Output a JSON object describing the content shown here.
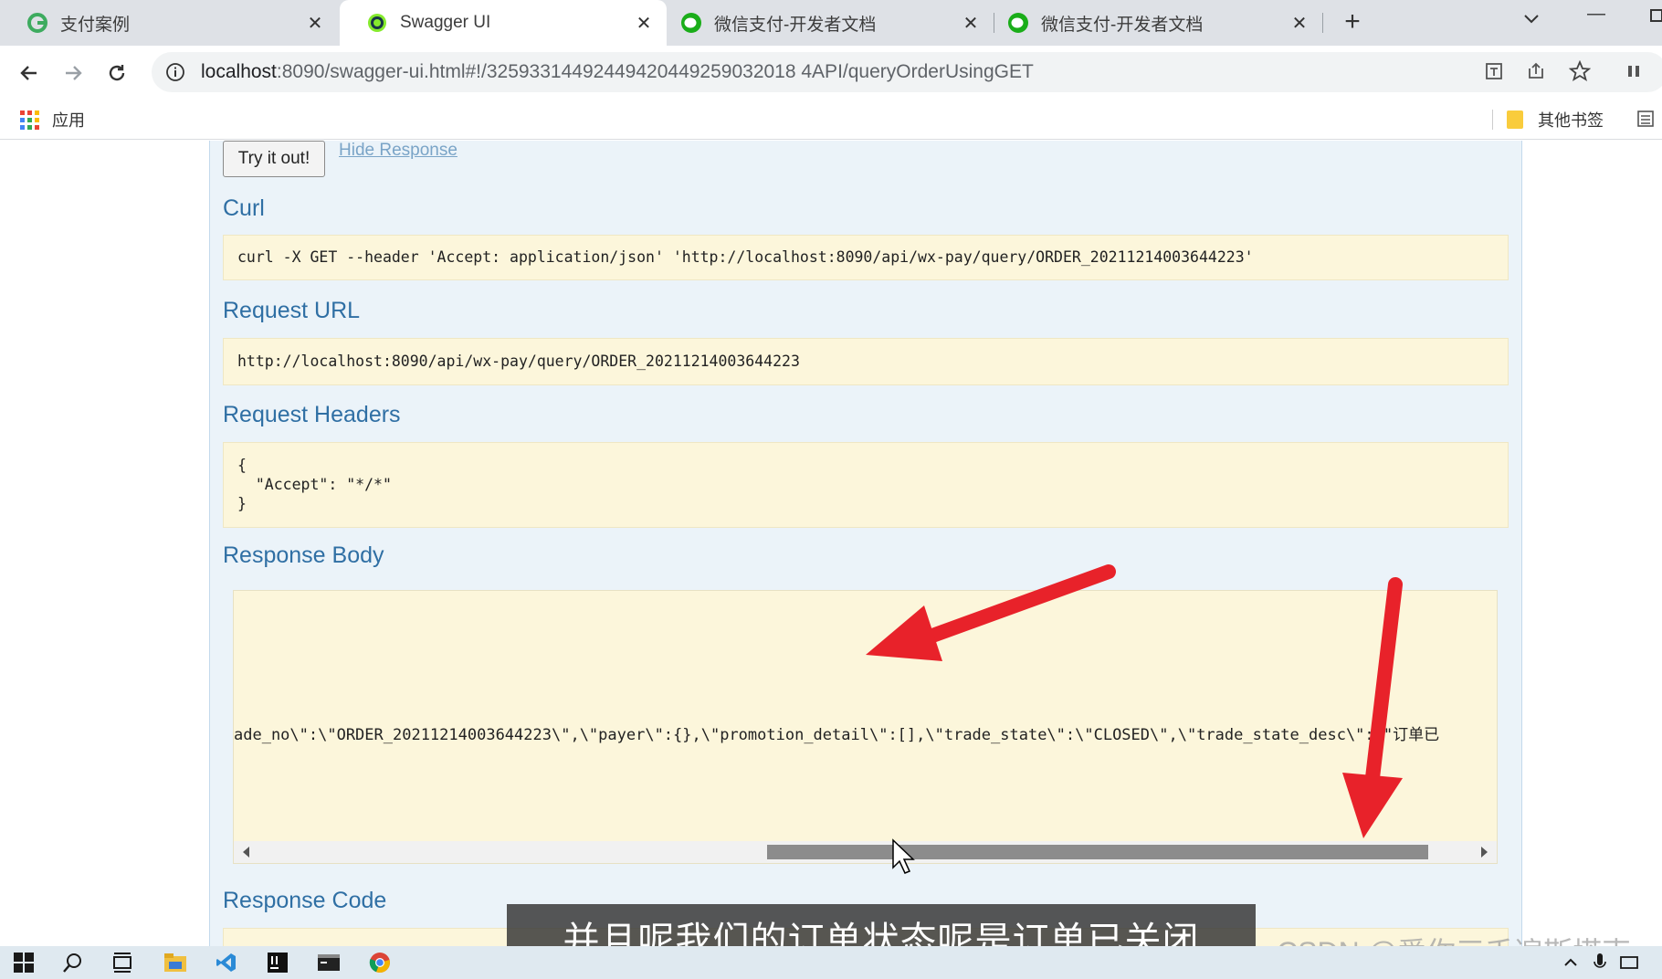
{
  "browser": {
    "tabs": [
      {
        "title": "支付案例",
        "active": false
      },
      {
        "title": "Swagger UI",
        "active": true
      },
      {
        "title": "微信支付-开发者文档",
        "active": false
      },
      {
        "title": "微信支付-开发者文档",
        "active": false
      }
    ],
    "new_tab": "+",
    "url_host": "localhost",
    "url_rest": ":8090/swagger-ui.html#!/32593314492449420449259032018 4API/queryOrderUsingGET",
    "bookmarks": {
      "apps_label": "应用",
      "other_label": "其他书签"
    }
  },
  "swagger": {
    "try_button": "Try it out!",
    "hide_response": "Hide Response",
    "curl_title": "Curl",
    "curl_value": "curl -X GET --header 'Accept: application/json' 'http://localhost:8090/api/wx-pay/query/ORDER_20211214003644223'",
    "request_url_title": "Request URL",
    "request_url_value": "http://localhost:8090/api/wx-pay/query/ORDER_20211214003644223",
    "request_headers_title": "Request Headers",
    "request_headers_value": "{\n  \"Accept\": \"*/*\"\n}",
    "response_body_title": "Response Body",
    "response_body_value": "ade_no\\\":\\\"ORDER_20211214003644223\\\",\\\"payer\\\":{},\\\"promotion_detail\\\":[],\\\"trade_state\\\":\\\"CLOSED\\\",\\\"trade_state_desc\\\":\\\"订单已",
    "response_code_title": "Response Code"
  },
  "video": {
    "subtitle": "并且呢我们的订单状态呢是订单已关闭",
    "watermark": "CSDN @爱你三千遍斯塔克"
  },
  "colors": {
    "swagger_heading": "#2f6fa4",
    "code_background": "#fcf6db",
    "panel_background": "#ebf3f9",
    "annotation_arrow": "#e8222a"
  }
}
